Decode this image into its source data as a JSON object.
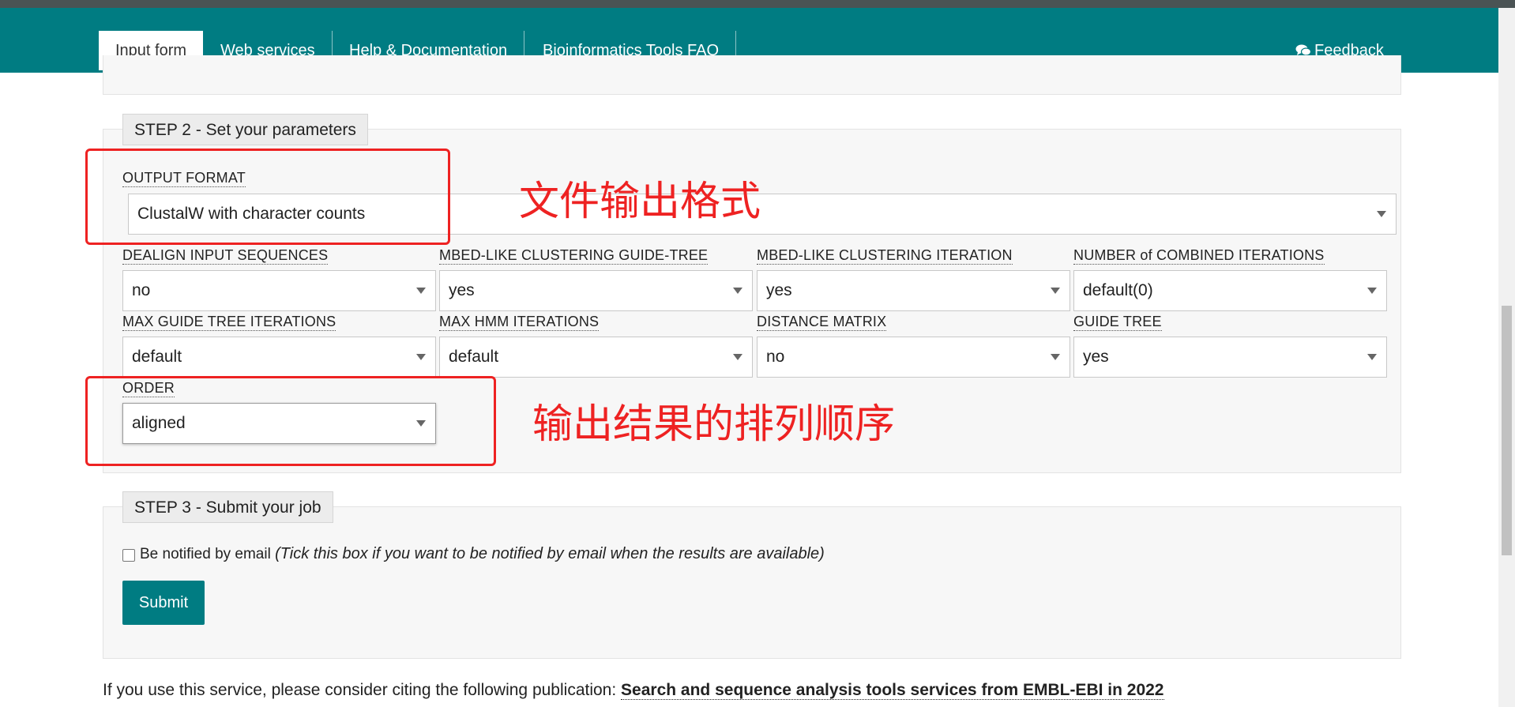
{
  "nav": {
    "tabs": [
      {
        "label": "Input form",
        "active": true
      },
      {
        "label": "Web services",
        "active": false
      },
      {
        "label": "Help & Documentation",
        "active": false
      },
      {
        "label": "Bioinformatics Tools FAQ",
        "active": false
      }
    ],
    "feedback_label": "Feedback",
    "feedback_icon": "chat-bubbles-icon"
  },
  "step2": {
    "legend": "STEP 2 - Set your parameters",
    "output_format": {
      "label": "OUTPUT FORMAT",
      "value": "ClustalW with character counts"
    },
    "dealign": {
      "label": "DEALIGN INPUT SEQUENCES",
      "value": "no"
    },
    "mbed_guide_tree": {
      "label": "MBED-LIKE CLUSTERING GUIDE-TREE",
      "value": "yes"
    },
    "mbed_iteration": {
      "label": "MBED-LIKE CLUSTERING ITERATION",
      "value": "yes"
    },
    "combined_iterations": {
      "label": "NUMBER of COMBINED ITERATIONS",
      "value": "default(0)"
    },
    "max_guide_tree_iterations": {
      "label": "MAX GUIDE TREE ITERATIONS",
      "value": "default"
    },
    "max_hmm_iterations": {
      "label": "MAX HMM ITERATIONS",
      "value": "default"
    },
    "distance_matrix": {
      "label": "DISTANCE MATRIX",
      "value": "no"
    },
    "guide_tree": {
      "label": "GUIDE TREE",
      "value": "yes"
    },
    "order": {
      "label": "ORDER",
      "value": "aligned"
    }
  },
  "annotations": {
    "output_format_note": "文件输出格式",
    "order_note": "输出结果的排列顺序",
    "color": "#ee2222"
  },
  "step3": {
    "legend": "STEP 3 - Submit your job",
    "notify_label": "Be notified by email",
    "notify_hint": "(Tick this box if you want to be notified by email when the results are available)",
    "notify_checked": false,
    "submit_label": "Submit"
  },
  "footer": {
    "cite_prefix": "If you use this service, please consider citing the following publication:",
    "cite_link": "Search and sequence analysis tools services from EMBL-EBI in 2022"
  },
  "colors": {
    "brand": "#007c82",
    "panel": "#f7f7f7"
  }
}
